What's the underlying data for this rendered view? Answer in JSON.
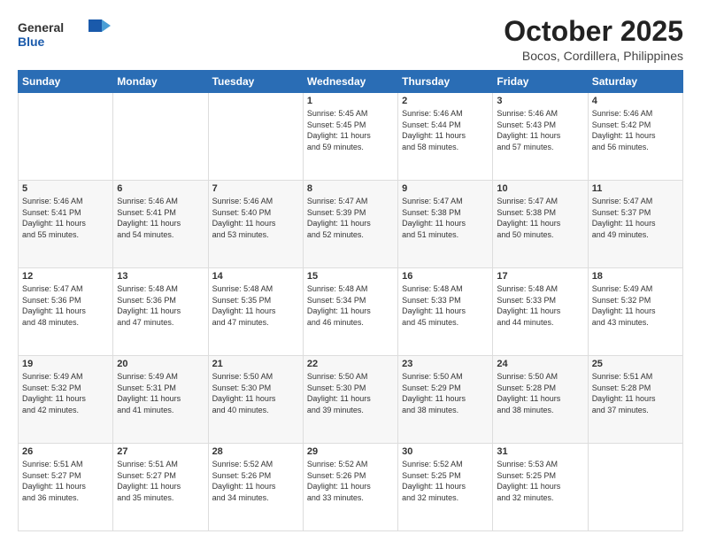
{
  "header": {
    "logo_general": "General",
    "logo_blue": "Blue",
    "month": "October 2025",
    "location": "Bocos, Cordillera, Philippines"
  },
  "weekdays": [
    "Sunday",
    "Monday",
    "Tuesday",
    "Wednesday",
    "Thursday",
    "Friday",
    "Saturday"
  ],
  "weeks": [
    [
      {
        "day": "",
        "info": ""
      },
      {
        "day": "",
        "info": ""
      },
      {
        "day": "",
        "info": ""
      },
      {
        "day": "1",
        "info": "Sunrise: 5:45 AM\nSunset: 5:45 PM\nDaylight: 11 hours\nand 59 minutes."
      },
      {
        "day": "2",
        "info": "Sunrise: 5:46 AM\nSunset: 5:44 PM\nDaylight: 11 hours\nand 58 minutes."
      },
      {
        "day": "3",
        "info": "Sunrise: 5:46 AM\nSunset: 5:43 PM\nDaylight: 11 hours\nand 57 minutes."
      },
      {
        "day": "4",
        "info": "Sunrise: 5:46 AM\nSunset: 5:42 PM\nDaylight: 11 hours\nand 56 minutes."
      }
    ],
    [
      {
        "day": "5",
        "info": "Sunrise: 5:46 AM\nSunset: 5:41 PM\nDaylight: 11 hours\nand 55 minutes."
      },
      {
        "day": "6",
        "info": "Sunrise: 5:46 AM\nSunset: 5:41 PM\nDaylight: 11 hours\nand 54 minutes."
      },
      {
        "day": "7",
        "info": "Sunrise: 5:46 AM\nSunset: 5:40 PM\nDaylight: 11 hours\nand 53 minutes."
      },
      {
        "day": "8",
        "info": "Sunrise: 5:47 AM\nSunset: 5:39 PM\nDaylight: 11 hours\nand 52 minutes."
      },
      {
        "day": "9",
        "info": "Sunrise: 5:47 AM\nSunset: 5:38 PM\nDaylight: 11 hours\nand 51 minutes."
      },
      {
        "day": "10",
        "info": "Sunrise: 5:47 AM\nSunset: 5:38 PM\nDaylight: 11 hours\nand 50 minutes."
      },
      {
        "day": "11",
        "info": "Sunrise: 5:47 AM\nSunset: 5:37 PM\nDaylight: 11 hours\nand 49 minutes."
      }
    ],
    [
      {
        "day": "12",
        "info": "Sunrise: 5:47 AM\nSunset: 5:36 PM\nDaylight: 11 hours\nand 48 minutes."
      },
      {
        "day": "13",
        "info": "Sunrise: 5:48 AM\nSunset: 5:36 PM\nDaylight: 11 hours\nand 47 minutes."
      },
      {
        "day": "14",
        "info": "Sunrise: 5:48 AM\nSunset: 5:35 PM\nDaylight: 11 hours\nand 47 minutes."
      },
      {
        "day": "15",
        "info": "Sunrise: 5:48 AM\nSunset: 5:34 PM\nDaylight: 11 hours\nand 46 minutes."
      },
      {
        "day": "16",
        "info": "Sunrise: 5:48 AM\nSunset: 5:33 PM\nDaylight: 11 hours\nand 45 minutes."
      },
      {
        "day": "17",
        "info": "Sunrise: 5:48 AM\nSunset: 5:33 PM\nDaylight: 11 hours\nand 44 minutes."
      },
      {
        "day": "18",
        "info": "Sunrise: 5:49 AM\nSunset: 5:32 PM\nDaylight: 11 hours\nand 43 minutes."
      }
    ],
    [
      {
        "day": "19",
        "info": "Sunrise: 5:49 AM\nSunset: 5:32 PM\nDaylight: 11 hours\nand 42 minutes."
      },
      {
        "day": "20",
        "info": "Sunrise: 5:49 AM\nSunset: 5:31 PM\nDaylight: 11 hours\nand 41 minutes."
      },
      {
        "day": "21",
        "info": "Sunrise: 5:50 AM\nSunset: 5:30 PM\nDaylight: 11 hours\nand 40 minutes."
      },
      {
        "day": "22",
        "info": "Sunrise: 5:50 AM\nSunset: 5:30 PM\nDaylight: 11 hours\nand 39 minutes."
      },
      {
        "day": "23",
        "info": "Sunrise: 5:50 AM\nSunset: 5:29 PM\nDaylight: 11 hours\nand 38 minutes."
      },
      {
        "day": "24",
        "info": "Sunrise: 5:50 AM\nSunset: 5:28 PM\nDaylight: 11 hours\nand 38 minutes."
      },
      {
        "day": "25",
        "info": "Sunrise: 5:51 AM\nSunset: 5:28 PM\nDaylight: 11 hours\nand 37 minutes."
      }
    ],
    [
      {
        "day": "26",
        "info": "Sunrise: 5:51 AM\nSunset: 5:27 PM\nDaylight: 11 hours\nand 36 minutes."
      },
      {
        "day": "27",
        "info": "Sunrise: 5:51 AM\nSunset: 5:27 PM\nDaylight: 11 hours\nand 35 minutes."
      },
      {
        "day": "28",
        "info": "Sunrise: 5:52 AM\nSunset: 5:26 PM\nDaylight: 11 hours\nand 34 minutes."
      },
      {
        "day": "29",
        "info": "Sunrise: 5:52 AM\nSunset: 5:26 PM\nDaylight: 11 hours\nand 33 minutes."
      },
      {
        "day": "30",
        "info": "Sunrise: 5:52 AM\nSunset: 5:25 PM\nDaylight: 11 hours\nand 32 minutes."
      },
      {
        "day": "31",
        "info": "Sunrise: 5:53 AM\nSunset: 5:25 PM\nDaylight: 11 hours\nand 32 minutes."
      },
      {
        "day": "",
        "info": ""
      }
    ]
  ]
}
